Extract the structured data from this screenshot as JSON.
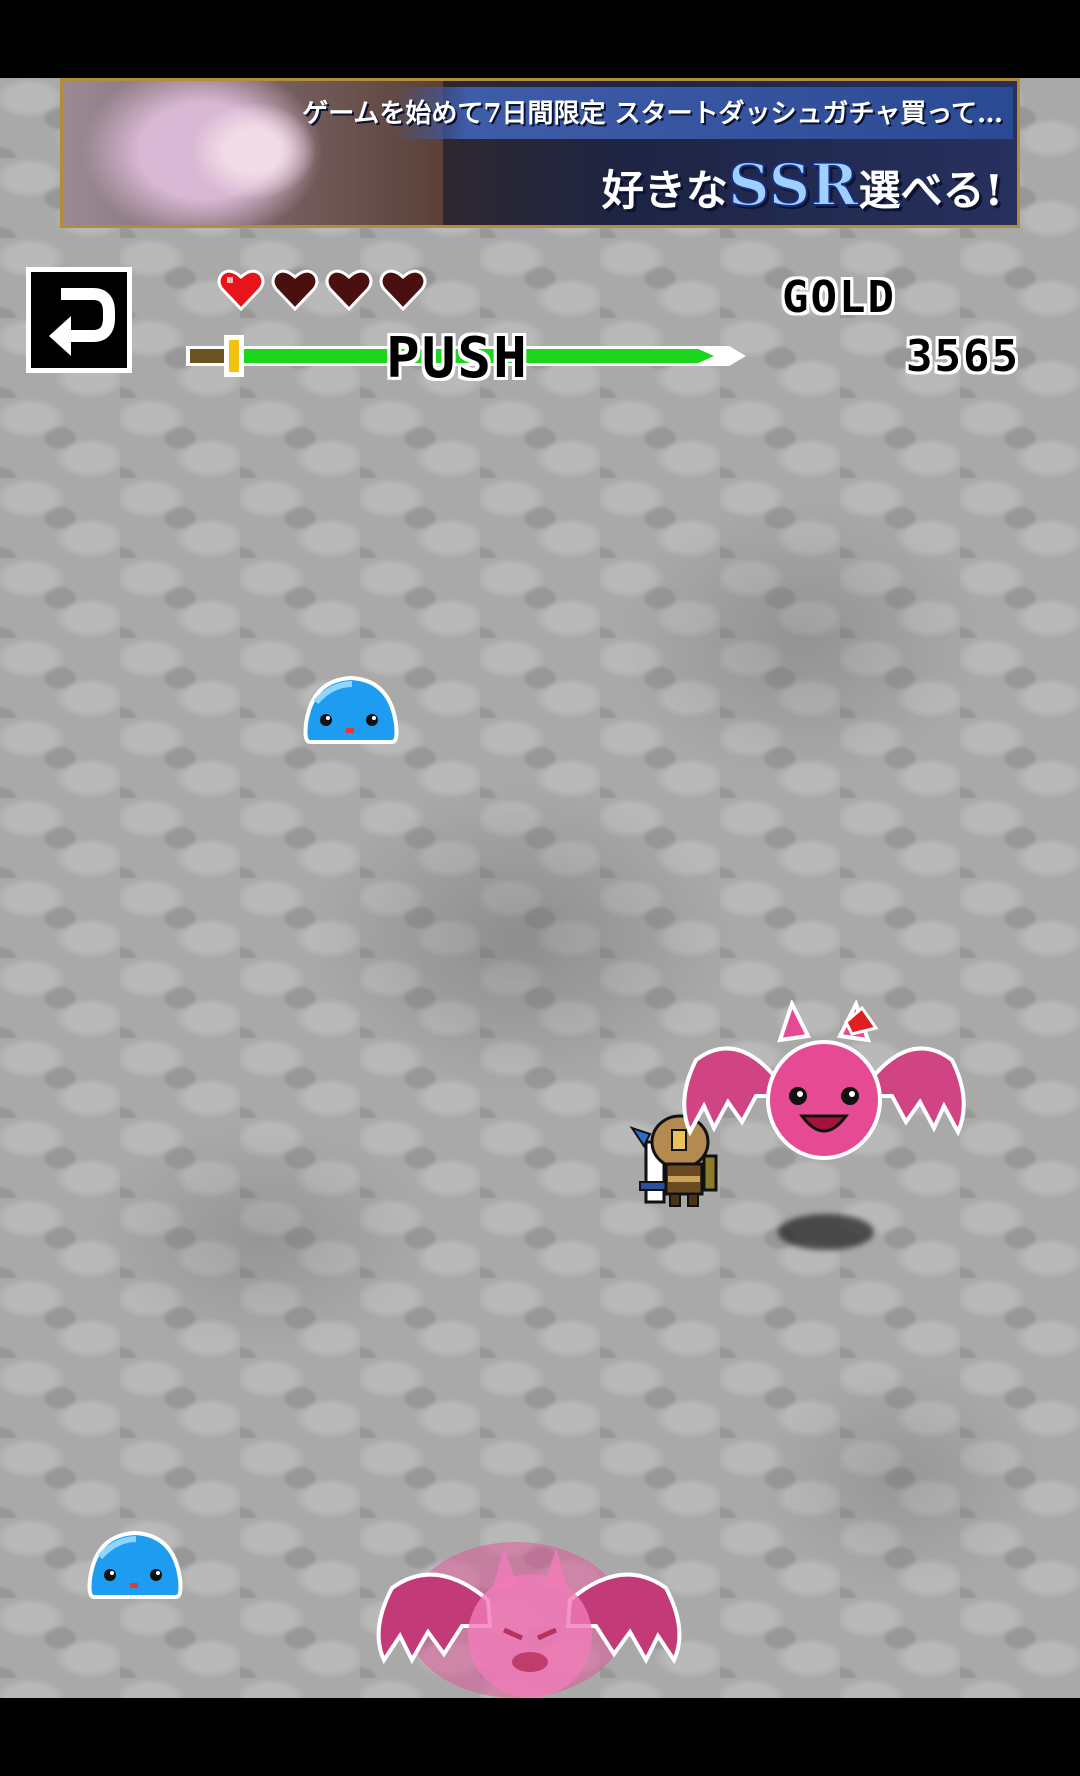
{
  "ad": {
    "headline": "ゲームを始めて7日間限定 スタートダッシュガチャ買って…",
    "tagline_pre": "好きな",
    "tagline_ssr": "SSR",
    "tagline_post": "選べる!"
  },
  "hud": {
    "back_icon": "return-arrow-icon",
    "hearts": {
      "filled": 1,
      "total": 4
    },
    "gauge": {
      "label": "PUSH",
      "level": 0.95
    },
    "gold_label": "GOLD",
    "gold_value": "3565"
  },
  "colors": {
    "heart_full": "#e8141c",
    "heart_empty": "#4a1010",
    "gauge_fill": "#1ed51e",
    "slime": "#1e9cf0",
    "bat": "#e64a92"
  },
  "sprites": [
    "blue-slime",
    "hero-knight",
    "pink-bat-demon",
    "blue-slime",
    "pink-bat-demon-ghost"
  ]
}
